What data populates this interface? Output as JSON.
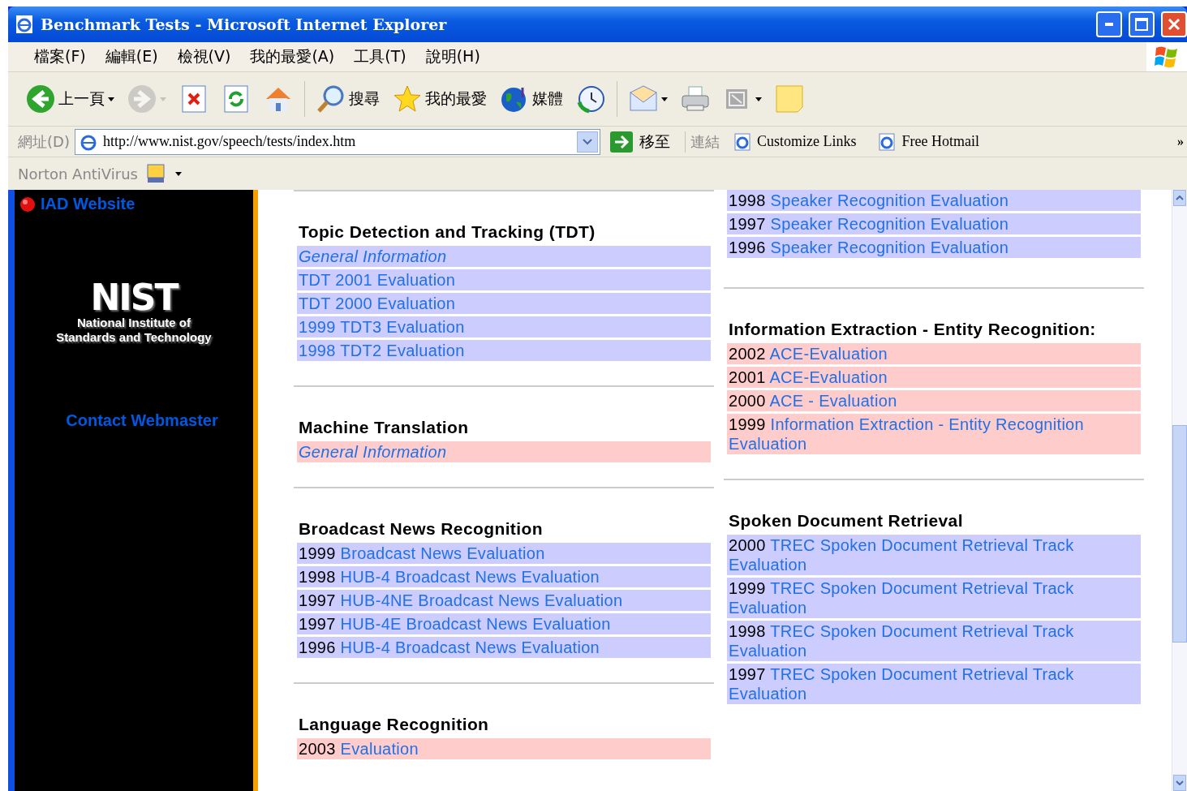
{
  "window": {
    "title": "Benchmark Tests - Microsoft Internet Explorer"
  },
  "menu": [
    "檔案(F)",
    "編輯(E)",
    "檢視(V)",
    "我的最愛(A)",
    "工具(T)",
    "說明(H)"
  ],
  "toolbar": [
    {
      "kind": "back",
      "label": "上一頁",
      "dropdown": true,
      "disabled": false
    },
    {
      "kind": "forward",
      "dropdown": true,
      "disabled": true
    },
    {
      "kind": "stop",
      "dropdown": false,
      "disabled": false
    },
    {
      "kind": "refresh",
      "dropdown": false,
      "disabled": false
    },
    {
      "kind": "home",
      "dropdown": false,
      "disabled": false
    },
    {
      "kind": "search",
      "label": "搜尋",
      "dropdown": false,
      "disabled": false
    },
    {
      "kind": "favorites",
      "label": "我的最愛",
      "dropdown": false,
      "disabled": false
    },
    {
      "kind": "media",
      "label": "媒體",
      "dropdown": false,
      "disabled": false
    },
    {
      "kind": "history",
      "dropdown": false,
      "disabled": false
    },
    {
      "kind": "mail",
      "dropdown": true,
      "disabled": false
    },
    {
      "kind": "print",
      "dropdown": false,
      "disabled": false
    },
    {
      "kind": "resize",
      "dropdown": true,
      "disabled": false
    },
    {
      "kind": "note",
      "dropdown": false,
      "disabled": false
    }
  ],
  "address": {
    "label": "網址(D)",
    "value": "http://www.nist.gov/speech/tests/index.htm",
    "go": "移至",
    "links_label": "連結",
    "links": [
      "Customize Links",
      "Free Hotmail"
    ],
    "more": "»"
  },
  "norton": {
    "label": "Norton AntiVirus"
  },
  "sidebar": {
    "top_link": "IAD Website",
    "logo": {
      "mark": "NIST",
      "line_1": "National Institute of",
      "line_2": "Standards and Technology"
    },
    "contact": "Contact Webmaster"
  },
  "columns": [
    [
      {
        "title": "Topic Detection and Tracking (TDT)",
        "color": "#ccccff",
        "items": [
          {
            "kind": "info",
            "link": "General Information"
          },
          {
            "kind": "eval",
            "link": "TDT 2001 Evaluation"
          },
          {
            "kind": "eval",
            "link": "TDT 2000 Evaluation"
          },
          {
            "kind": "eval",
            "link": "1999 TDT3 Evaluation"
          },
          {
            "kind": "eval",
            "link": "1998 TDT2 Evaluation"
          }
        ]
      },
      {
        "title": "Machine Translation",
        "color": "#ffcccc",
        "items": [
          {
            "kind": "info",
            "link": "General Information"
          }
        ]
      },
      {
        "title": "Broadcast News Recognition",
        "color": "#ccccff",
        "items": [
          {
            "kind": "eval",
            "year": "1999",
            "link": "Broadcast News Evaluation"
          },
          {
            "kind": "eval",
            "year": "1998",
            "link": "HUB-4 Broadcast News Evaluation"
          },
          {
            "kind": "eval",
            "year": "1997",
            "link": "HUB-4NE Broadcast News Evaluation"
          },
          {
            "kind": "eval",
            "year": "1997",
            "link": "HUB-4E Broadcast News Evaluation"
          },
          {
            "kind": "eval",
            "year": "1996",
            "link": "HUB-4 Broadcast News Evaluation"
          }
        ]
      },
      {
        "title": "Language Recognition",
        "color": "#ffcccc",
        "items": [
          {
            "kind": "eval",
            "year": "2003",
            "link": "Evaluation"
          }
        ]
      }
    ],
    [
      {
        "color": "#ccccff",
        "items": [
          {
            "kind": "eval",
            "year": "1998",
            "link": "Speaker Recognition Evaluation"
          },
          {
            "kind": "eval",
            "year": "1997",
            "link": "Speaker Recognition Evaluation"
          },
          {
            "kind": "eval",
            "year": "1996",
            "link": "Speaker Recognition Evaluation"
          }
        ]
      },
      {
        "title": "Information Extraction - Entity Recognition:",
        "color": "#ffcccc",
        "items": [
          {
            "kind": "eval",
            "year": "2002",
            "link": "ACE-Evaluation"
          },
          {
            "kind": "eval",
            "year": "2001",
            "link": "ACE-Evaluation"
          },
          {
            "kind": "eval",
            "year": "2000",
            "link": "ACE - Evaluation"
          },
          {
            "kind": "eval",
            "year": "1999",
            "link": "Information Extraction - Entity Recognition Evaluation"
          }
        ]
      },
      {
        "title": "Spoken Document Retrieval",
        "color": "#ccccff",
        "items": [
          {
            "kind": "eval",
            "year": "2000",
            "link": "TREC Spoken Document Retrieval Track Evaluation"
          },
          {
            "kind": "eval",
            "year": "1999",
            "link": "TREC Spoken Document Retrieval Track Evaluation"
          },
          {
            "kind": "eval",
            "year": "1998",
            "link": "TREC Spoken Document Retrieval Track Evaluation"
          },
          {
            "kind": "eval",
            "year": "1997",
            "link": "TREC Spoken Document Retrieval Track Evaluation"
          }
        ]
      }
    ]
  ]
}
